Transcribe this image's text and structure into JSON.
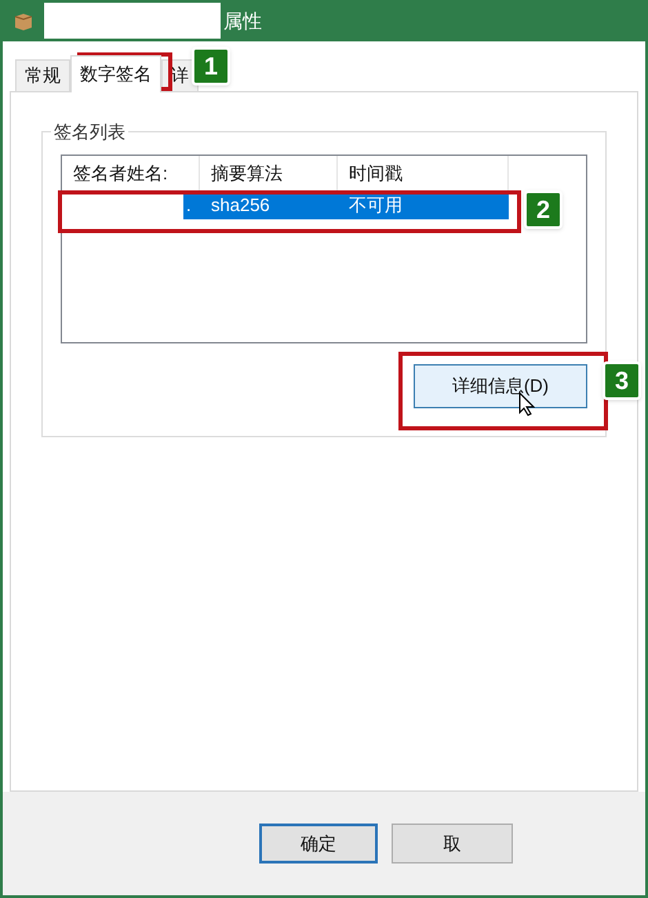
{
  "window": {
    "title": "属性"
  },
  "tabs": [
    {
      "label": "常规",
      "selected": false
    },
    {
      "label": "数字签名",
      "selected": true
    },
    {
      "label": "详",
      "selected": false
    }
  ],
  "group": {
    "title": "签名列表"
  },
  "table": {
    "columns": [
      "签名者姓名:",
      "摘要算法",
      "时间戳"
    ],
    "rows": [
      {
        "cells": [
          ".",
          "sha256",
          "不可用"
        ],
        "selected": true
      }
    ]
  },
  "details_button": {
    "label": "详细信息(D)"
  },
  "buttons": [
    "确定",
    "取"
  ],
  "annotations": [
    {
      "label": "1"
    },
    {
      "label": "2"
    },
    {
      "label": "3"
    }
  ]
}
